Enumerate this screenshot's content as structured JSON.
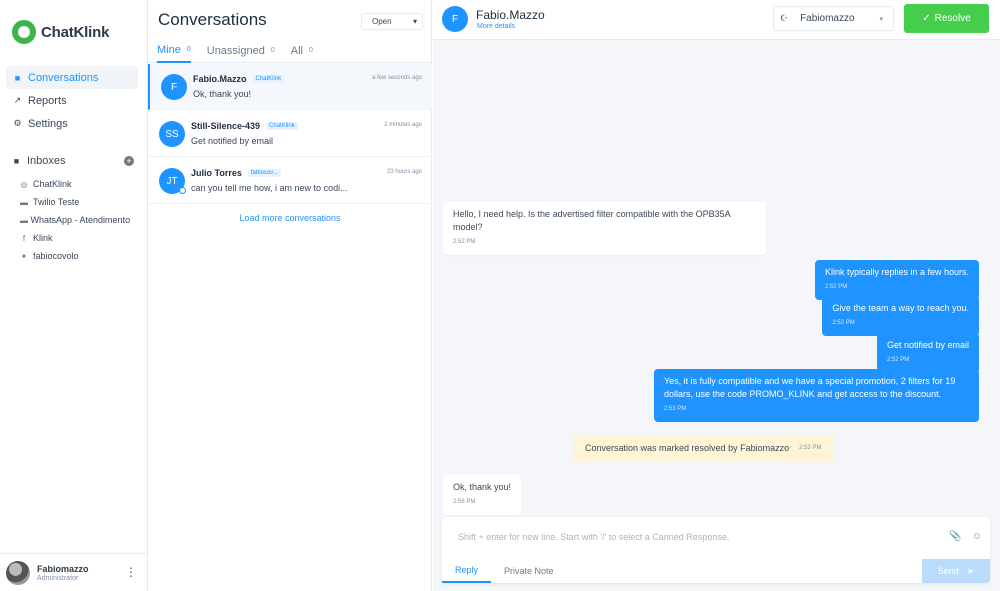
{
  "brand": {
    "name": "ChatKlink",
    "accent": "#1f93ff",
    "logo_color": "#3bb54a"
  },
  "sidebar": {
    "nav": [
      {
        "label": "Conversations",
        "icon": "chat-icon",
        "active": true
      },
      {
        "label": "Reports",
        "icon": "chart-icon",
        "active": false
      },
      {
        "label": "Settings",
        "icon": "settings-icon",
        "active": false
      }
    ],
    "inboxes_label": "Inboxes",
    "inboxes": [
      {
        "label": "ChatKlink",
        "icon": "globe-icon"
      },
      {
        "label": "Twilio Teste",
        "icon": "sms-icon"
      },
      {
        "label": "WhatsApp - Atendimento",
        "icon": "whatsapp-icon"
      },
      {
        "label": "Klink",
        "icon": "facebook-icon"
      },
      {
        "label": "fabiocovolo",
        "icon": "twitter-icon"
      }
    ],
    "profile": {
      "name": "Fabiomazzo",
      "role": "Administrator"
    }
  },
  "conversation_list": {
    "title": "Conversations",
    "status_filter": "Open",
    "tabs": [
      {
        "label": "Mine",
        "count": "0"
      },
      {
        "label": "Unassigned",
        "count": "0"
      },
      {
        "label": "All",
        "count": "0"
      }
    ],
    "items": [
      {
        "initials": "F",
        "name": "Fabio.Mazzo",
        "inbox": "ChatKlink",
        "time": "a few seconds ago",
        "message": "Ok, thank you!"
      },
      {
        "initials": "SS",
        "name": "Still-Silence-439",
        "inbox": "ChatKlink",
        "time": "2 minutes ago",
        "message": "Get notified by email"
      },
      {
        "initials": "JT",
        "name": "Julio Torres",
        "inbox": "fabiocov...",
        "time": "23 hours ago",
        "message": "can you tell me how, i am new to codi..."
      }
    ],
    "load_more": "Load more conversations"
  },
  "chat": {
    "contact_initial": "F",
    "contact_name": "Fabio.Mazzo",
    "more_details": "More details",
    "assignee": "Fabiomazzo",
    "resolve_label": "Resolve",
    "messages": [
      {
        "text": "Hello, I need help. Is the advertised filter compatible with the OPB35A model?",
        "time": "2:52 PM"
      },
      {
        "text": "Klink typically replies in a few hours.",
        "time": "2:52 PM"
      },
      {
        "text": "Give the team a way to reach you.",
        "time": "2:52 PM"
      },
      {
        "text": "Get notified by email",
        "time": "2:52 PM"
      },
      {
        "text": "Yes, it is fully compatible and we have a special promotion, 2 filters for 19 dollars, use the code PROMO_KLINK and get access to the discount.",
        "time": "2:53 PM"
      },
      {
        "text": "Ok, thank you!",
        "time": "2:56 PM"
      }
    ],
    "activity": {
      "text": "Conversation was marked resolved by Fabiomazzo",
      "time": "2:53 PM"
    },
    "composer": {
      "placeholder": "Shift + enter for new line. Start with '/' to select a Canned Response.",
      "reply_tab": "Reply",
      "note_tab": "Private Note",
      "send_label": "Send"
    }
  }
}
